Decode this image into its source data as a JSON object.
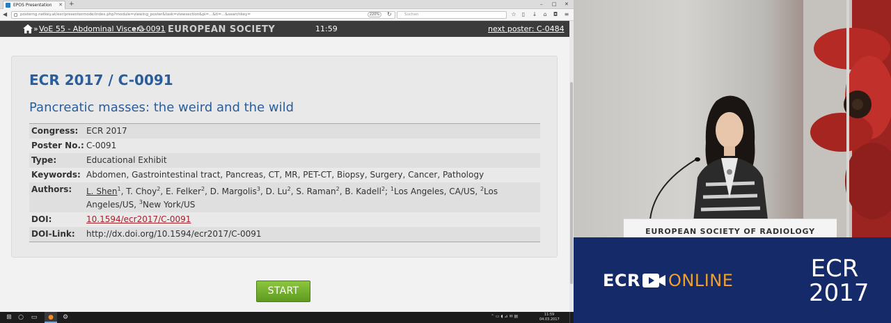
{
  "browser": {
    "tab_title": "EPOS Presentation",
    "new_tab": "+",
    "url": "posterng.netkey.at/esr/presentermode/index.php?module=viewing_poster&task=viewsection&pi=...&ti=...&searchkey=",
    "zoom": "220%",
    "search_placeholder": "Suchen",
    "window_controls": [
      "–",
      "□",
      "✕"
    ]
  },
  "epos_bar": {
    "crumbs": [
      "VoE 55 - Abdominal Viscera",
      "C-0091"
    ],
    "logo_text": "EUROPEAN SOCIETY",
    "clock": "11:59",
    "next_poster": "next poster: C-0484"
  },
  "poster": {
    "title": "ECR 2017 / C-0091",
    "heading": "Pancreatic masses: the weird and the wild",
    "rows": [
      {
        "key": "Congress:",
        "value": "ECR 2017"
      },
      {
        "key": "Poster No.:",
        "value": "C-0091"
      },
      {
        "key": "Type:",
        "value": "Educational Exhibit"
      },
      {
        "key": "Keywords:",
        "value": "Abdomen, Gastrointestinal tract, Pancreas, CT, MR, PET-CT, Biopsy, Surgery, Cancer, Pathology"
      },
      {
        "key": "Authors:",
        "authors": [
          {
            "name": "L. Shen",
            "sup": "1"
          },
          {
            "name": "T. Choy",
            "sup": "2"
          },
          {
            "name": "E. Felker",
            "sup": "2"
          },
          {
            "name": "D. Margolis",
            "sup": "3"
          },
          {
            "name": "D. Lu",
            "sup": "2"
          },
          {
            "name": "S. Raman",
            "sup": "2"
          },
          {
            "name": "B. Kadell",
            "sup": "2"
          }
        ],
        "affiliations": [
          {
            "sup": "1",
            "place": "Los Angeles, CA/US"
          },
          {
            "sup": "2",
            "place": "Los Angeles/US"
          },
          {
            "sup": "3",
            "place": "New York/US"
          }
        ]
      },
      {
        "key": "DOI:",
        "value": "10.1594/ecr2017/C-0091"
      },
      {
        "key": "DOI-Link:",
        "value": "http://dx.doi.org/10.1594/ecr2017/C-0091"
      }
    ],
    "start_label": "START"
  },
  "taskbar": {
    "clock_time": "11:59",
    "clock_date": "04.03.2017"
  },
  "video": {
    "podium_text": "EUROPEAN SOCIETY OF RADIOLOGY",
    "brand_ecr": "ECR",
    "brand_online": "ONLINE",
    "brand_year_top": "ECR",
    "brand_year_bottom": "2017"
  },
  "colors": {
    "poster_blue": "#2a5d9c",
    "doi_red": "#a5202a",
    "start_green": "#6aa72a",
    "banner_navy": "#152a68",
    "online_orange": "#f0a02b"
  }
}
